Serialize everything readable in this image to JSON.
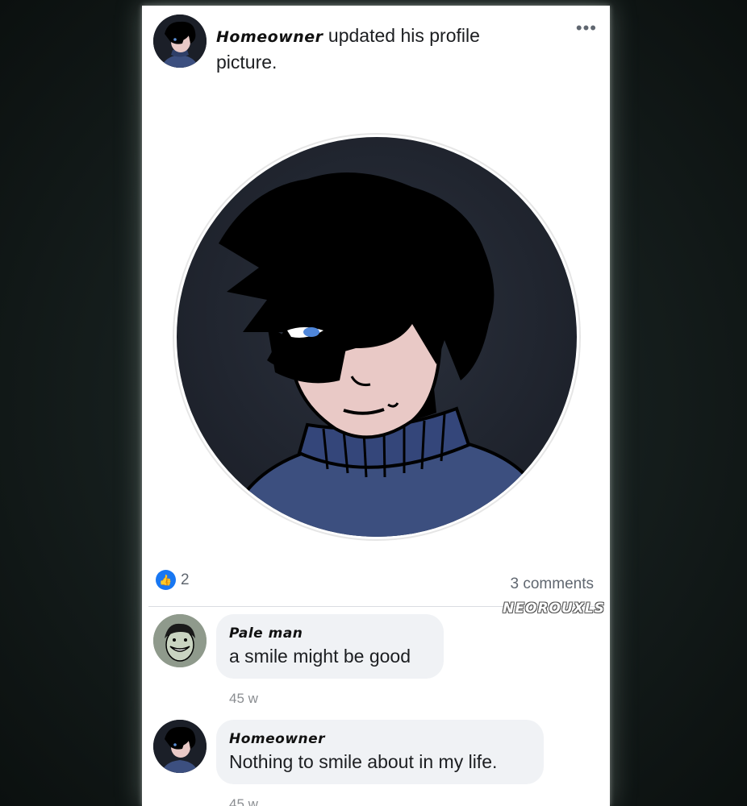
{
  "post": {
    "author": "Homeowner",
    "action_text": "updated his profile picture.",
    "more_icon": "more-horizontal-icon",
    "reaction_icon": "like-icon",
    "reactions_count": "2",
    "comments_count_label": "3 comments"
  },
  "watermark": "NEOROUXLS",
  "comments": [
    {
      "author": "Pale man",
      "text": "a smile might be good",
      "time": "45 w"
    },
    {
      "author": "Homeowner",
      "text": "Nothing to smile about in my life.",
      "time": "45 w"
    }
  ],
  "colors": {
    "like_blue": "#1877f2",
    "bubble_gray": "#f0f2f5",
    "sweater_blue": "#3c4f7f",
    "avatar_bg": "#1b1f28"
  }
}
